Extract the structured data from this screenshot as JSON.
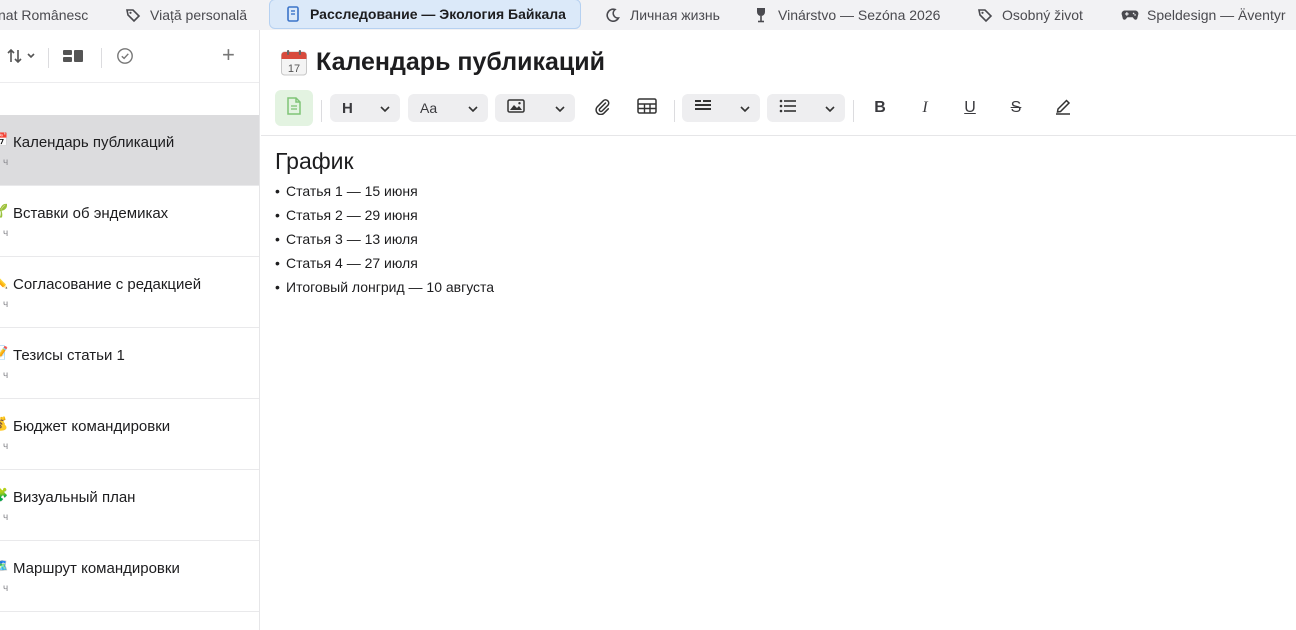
{
  "tabs": [
    {
      "label": "nat Românesc",
      "icon": "none",
      "active": false
    },
    {
      "label": "Viață personală",
      "icon": "tag-icon",
      "active": false
    },
    {
      "label": "Расследование — Экология Байкала",
      "icon": "notebook-icon",
      "active": true
    },
    {
      "label": "Личная жизнь",
      "icon": "moon-icon",
      "active": false
    },
    {
      "label": "Vinárstvo — Sezóna 2026",
      "icon": "wine-glass-icon",
      "active": false
    },
    {
      "label": "Osobný život",
      "icon": "tag-icon",
      "active": false
    },
    {
      "label": "Speldesign — Äventyr",
      "icon": "gamepad-icon",
      "active": false
    }
  ],
  "sidebar": {
    "toolbar": {
      "sort_icon": "sort-icon",
      "view_icon": "view-toggle-icon",
      "check_icon": "check-circle-icon",
      "add_label": "+"
    },
    "notes": [
      {
        "title": "Календарь публикаций",
        "meta": "ч",
        "emoji": "📅",
        "selected": true
      },
      {
        "title": "Вставки об эндемиках",
        "meta": "ч",
        "emoji": "🌱",
        "selected": false
      },
      {
        "title": "Согласование с редакцией",
        "meta": "ч",
        "emoji": "✏️",
        "selected": false
      },
      {
        "title": "Тезисы статьи 1",
        "meta": "ч",
        "emoji": "📝",
        "selected": false
      },
      {
        "title": "Бюджет командировки",
        "meta": "ч",
        "emoji": "💰",
        "selected": false
      },
      {
        "title": "Визуальный план",
        "meta": "ч",
        "emoji": "🧩",
        "selected": false
      },
      {
        "title": "Маршрут командировки",
        "meta": "ч",
        "emoji": "🗺️",
        "selected": false
      }
    ]
  },
  "editor": {
    "title": "Календарь публикаций",
    "title_icon": "calendar-icon",
    "calendar_day": "17",
    "toolbar": {
      "heading_label": "H",
      "font_label": "Aa"
    },
    "heading": "График",
    "items": [
      "Статья 1 — 15 июня",
      "Статья 2 — 29 июня",
      "Статья 3 — 13 июля",
      "Статья 4 — 27 июля",
      "Итоговый лонгрид — 10 августа"
    ],
    "bullet": "•"
  },
  "colors": {
    "active_tab_bg": "#dbe9f9",
    "selected_note_bg": "#dcdcde",
    "green_accent": "#7fc477"
  }
}
